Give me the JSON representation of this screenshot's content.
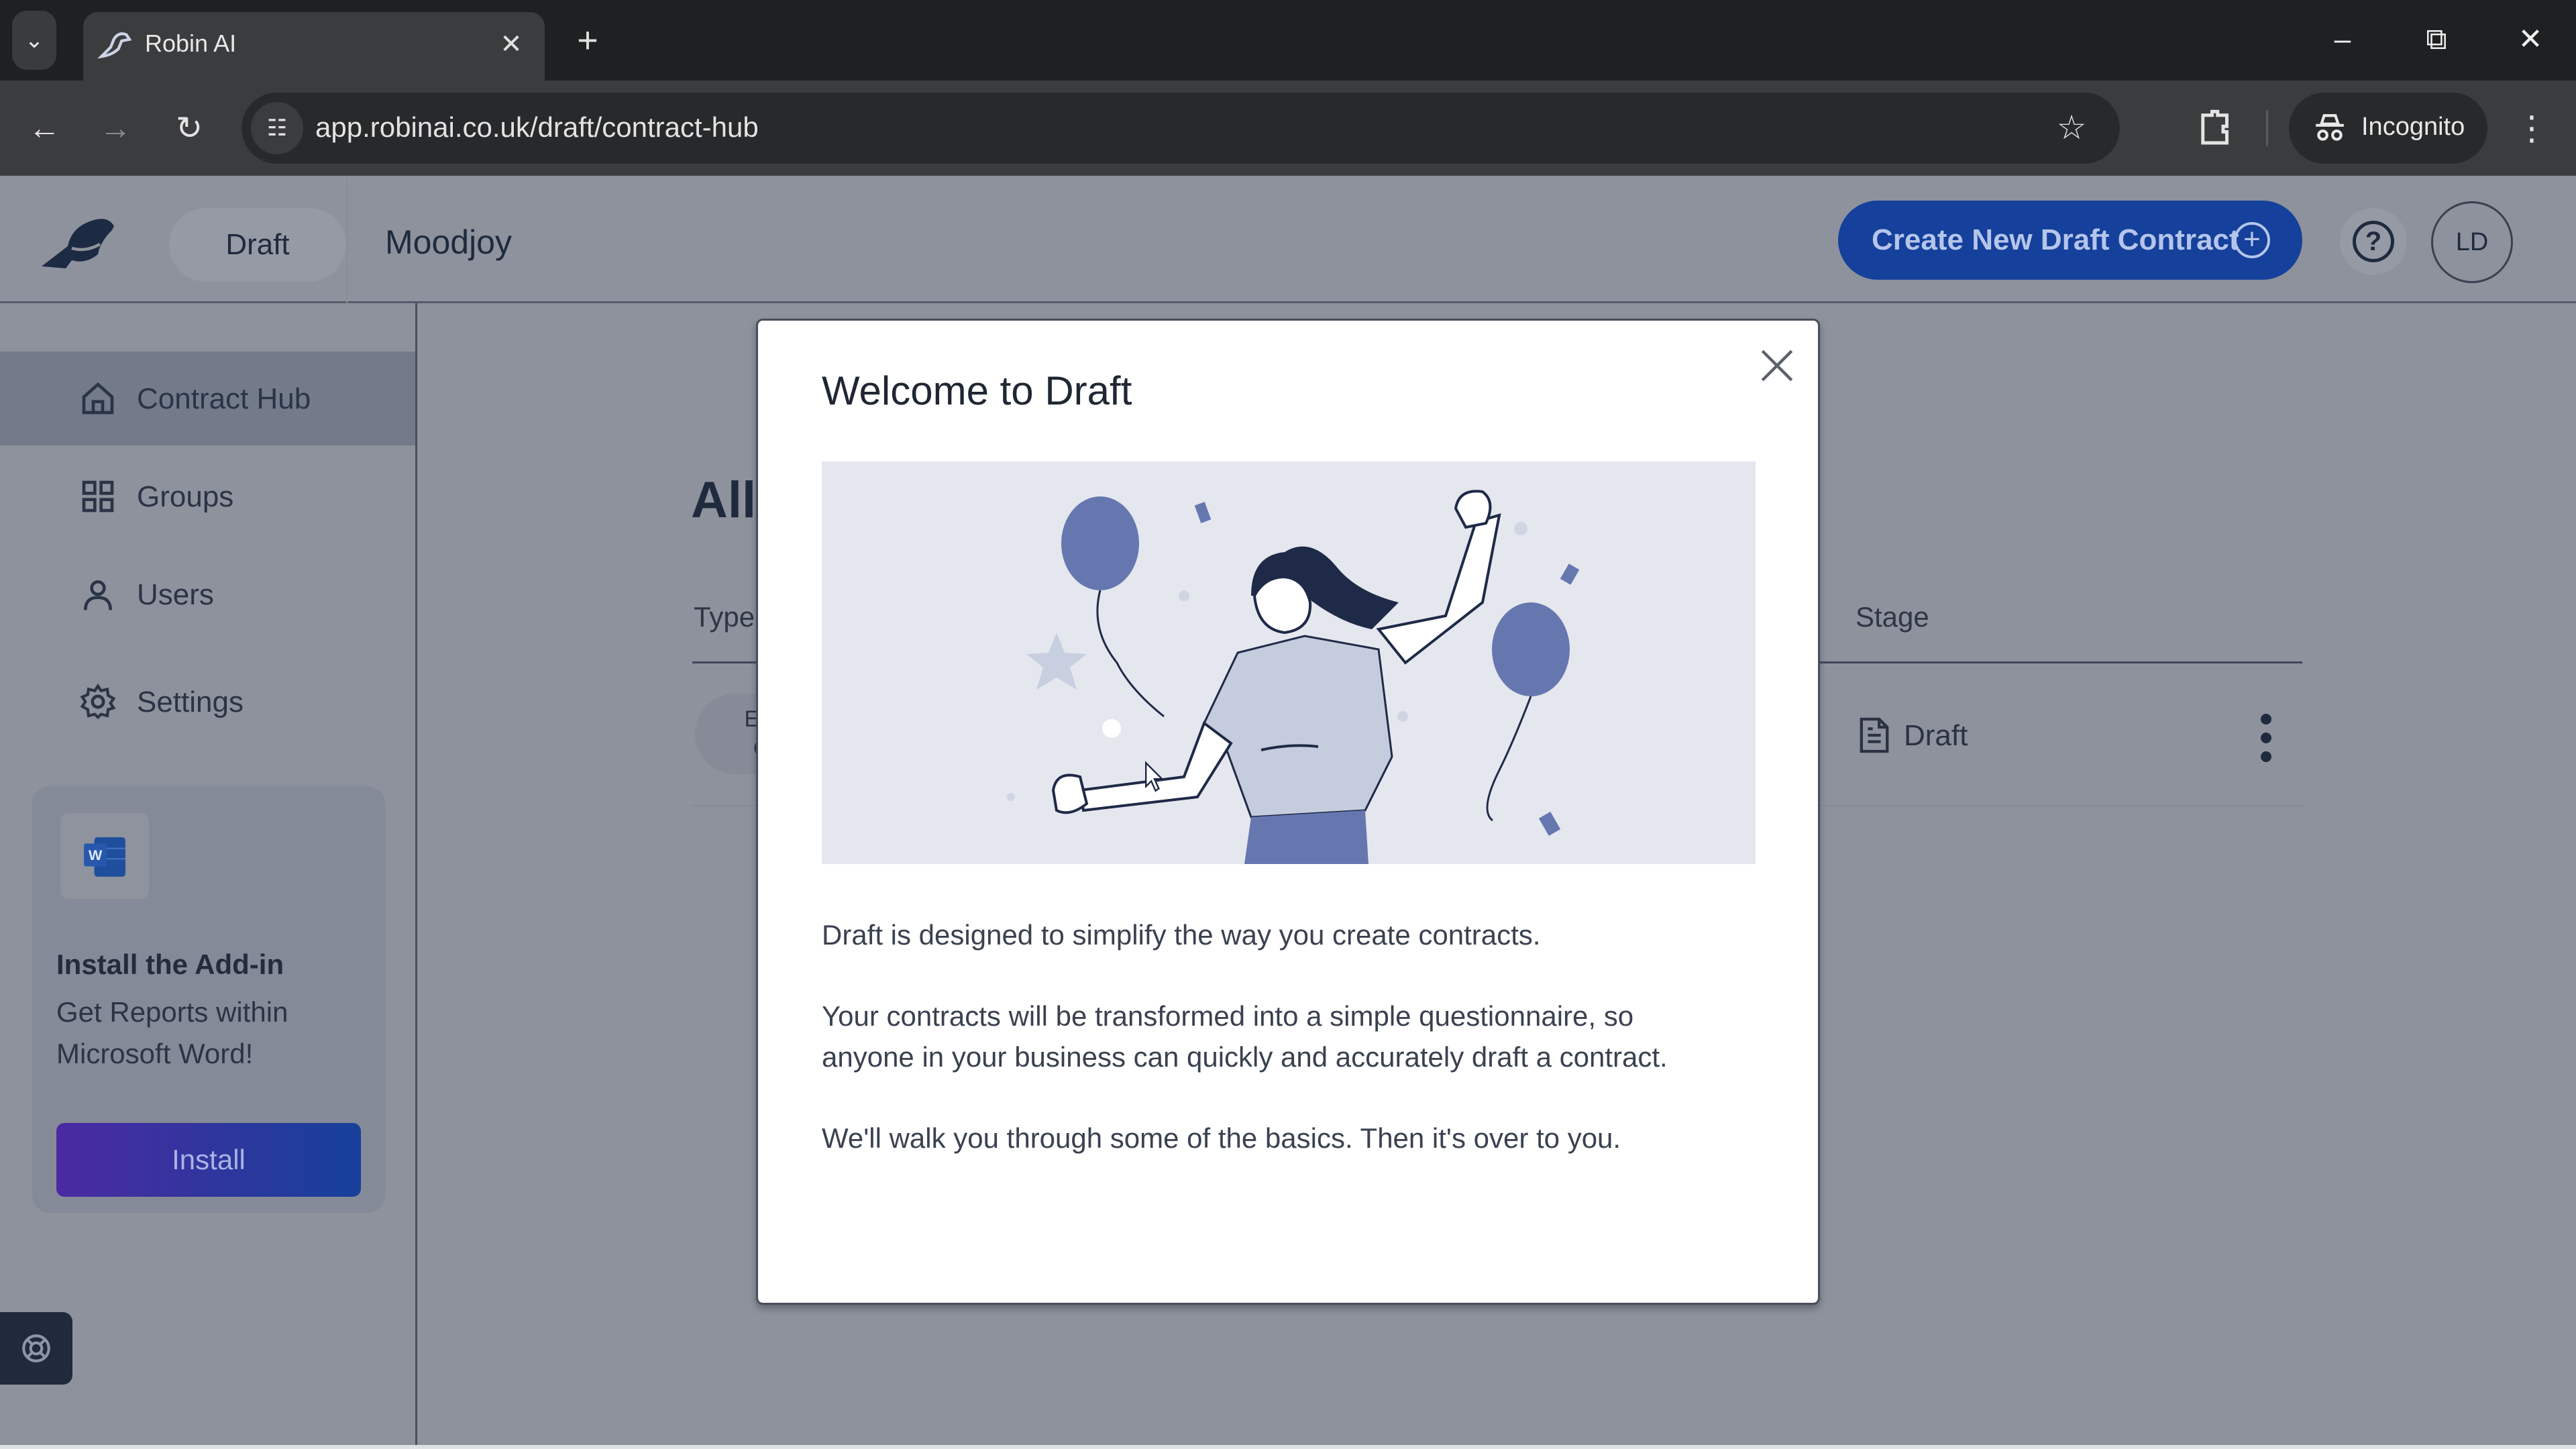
{
  "browser": {
    "tab_title": "Robin AI",
    "url": "app.robinai.co.uk/draft/contract-hub",
    "profile_label": "Incognito",
    "icons": {
      "tab_list": "chevron-down-icon",
      "tab_close": "close-icon",
      "new_tab": "plus-icon",
      "minimize": "minimize-icon",
      "restore": "restore-icon",
      "close": "close-icon",
      "back": "arrow-left-icon",
      "forward": "arrow-right-icon",
      "reload": "reload-icon",
      "site_info": "tune-icon",
      "bookmark": "star-icon",
      "extensions": "puzzle-icon",
      "incognito": "incognito-icon",
      "menu": "more-vertical-icon"
    }
  },
  "header": {
    "product": "Draft",
    "organization": "Moodjoy",
    "create_button": "Create New Draft Contract",
    "user_initials": "LD"
  },
  "sidebar": {
    "items": [
      {
        "label": "Contract Hub",
        "icon": "home-icon",
        "active": true
      },
      {
        "label": "Groups",
        "icon": "grid-icon",
        "active": false
      },
      {
        "label": "Users",
        "icon": "user-icon",
        "active": false
      },
      {
        "label": "Settings",
        "icon": "gear-icon",
        "active": false
      }
    ],
    "addin": {
      "title": "Install the Add-in",
      "description": "Get Reports within Microsoft Word!",
      "button": "Install"
    }
  },
  "main": {
    "title_partial": "All",
    "columns": {
      "type": "Type",
      "stage": "Stage"
    },
    "rows": [
      {
        "type_partial": "Em\nC",
        "stage": "Draft"
      }
    ]
  },
  "modal": {
    "title": "Welcome to Draft",
    "paragraphs": [
      "Draft is designed to simplify the way you create contracts.",
      "Your contracts will be transformed into a simple questionnaire, so anyone in your business can quickly and accurately draft a contract.",
      "We'll walk you through some of the basics. Then it's over to you."
    ],
    "illustration": "celebrating-person-with-balloons",
    "colors": {
      "balloon": "#6677b0",
      "hair": "#1f2a48",
      "shirt": "#c5ccdd",
      "background": "#e5e7ee"
    }
  },
  "colors": {
    "primary": "#15409b",
    "install_gradient_start": "#4b2aa2",
    "install_gradient_end": "#16409a",
    "overlay": "#8e929c"
  }
}
